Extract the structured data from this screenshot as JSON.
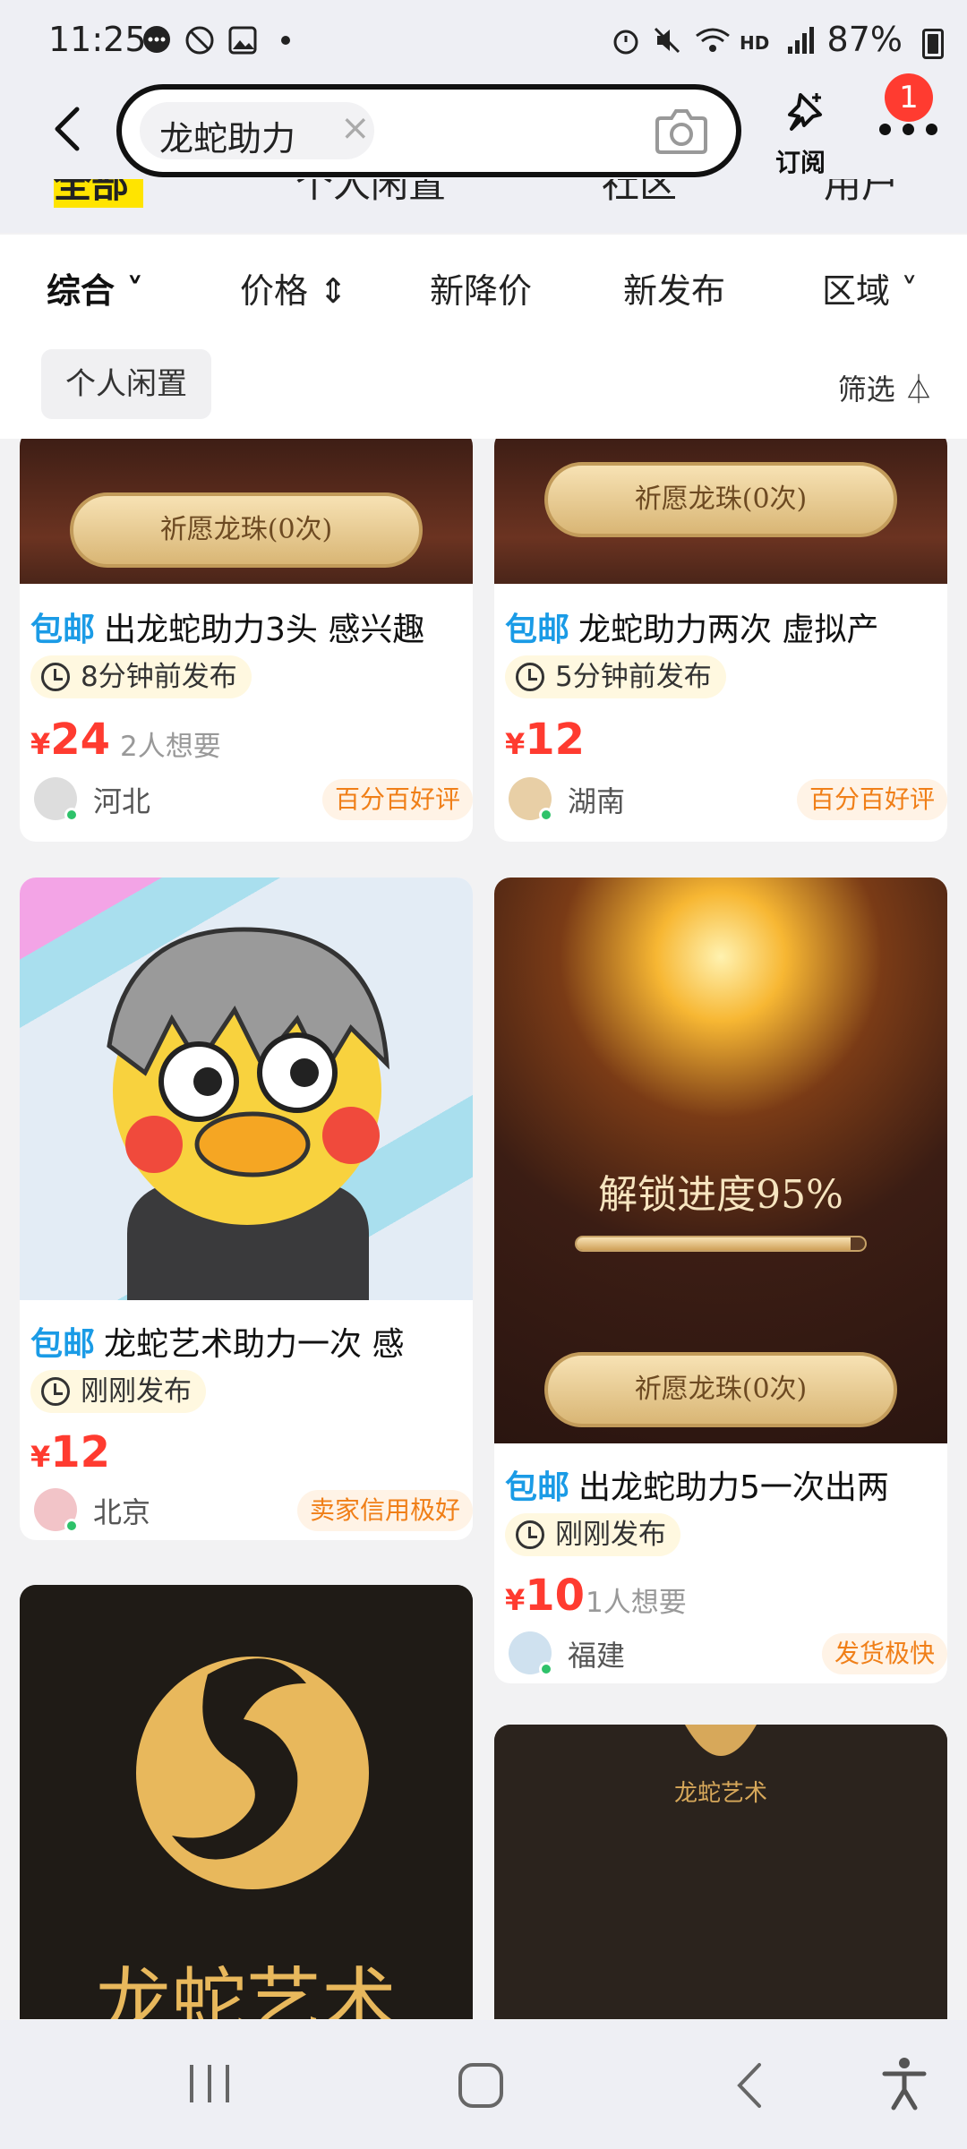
{
  "status_bar": {
    "time": "11:25",
    "battery": "87%"
  },
  "search": {
    "query": "龙蛇助力",
    "subscribe_label": "订阅",
    "notification_count": "1"
  },
  "tab_strip": {
    "tabs": [
      "全部",
      "个人闲置",
      "社区",
      "用户"
    ]
  },
  "sort_bar": {
    "items": [
      "综合",
      "价格",
      "新降价",
      "新发布",
      "区域"
    ],
    "filter_tag": "个人闲置",
    "filter_label": "筛选"
  },
  "listings": [
    {
      "tag": "包邮",
      "title": "出龙蛇助力3头 感兴趣",
      "posted": "8分钟前发布",
      "price": "24",
      "wants": "2人想要",
      "region": "河北",
      "reputation": "百分百好评",
      "image_text": "祈愿龙珠(0次)"
    },
    {
      "tag": "包邮",
      "title": "龙蛇助力两次 虚拟产",
      "posted": "5分钟前发布",
      "price": "12",
      "wants": "",
      "region": "湖南",
      "reputation": "百分百好评",
      "image_text": "祈愿龙珠(0次)"
    },
    {
      "tag": "包邮",
      "title": "龙蛇艺术助力一次 感",
      "posted": "刚刚发布",
      "price": "12",
      "wants": "",
      "region": "北京",
      "reputation": "卖家信用极好"
    },
    {
      "tag": "包邮",
      "title": "出龙蛇助力5一次出两",
      "posted": "刚刚发布",
      "price": "10",
      "wants": "1人想要",
      "region": "福建",
      "reputation": "发货极快",
      "image_text": "祈愿龙珠(0次)",
      "progress_text": "解锁进度95%",
      "progress": 0.95
    },
    {
      "image_text": "龙蛇艺术"
    },
    {
      "image_text": "龙蛇艺术"
    }
  ],
  "currency": "¥",
  "colors": {
    "accent_yellow": "#ffe400",
    "price_red": "#ff3b30",
    "tag_blue": "#1a9be6",
    "rep_orange": "#f07f18"
  }
}
